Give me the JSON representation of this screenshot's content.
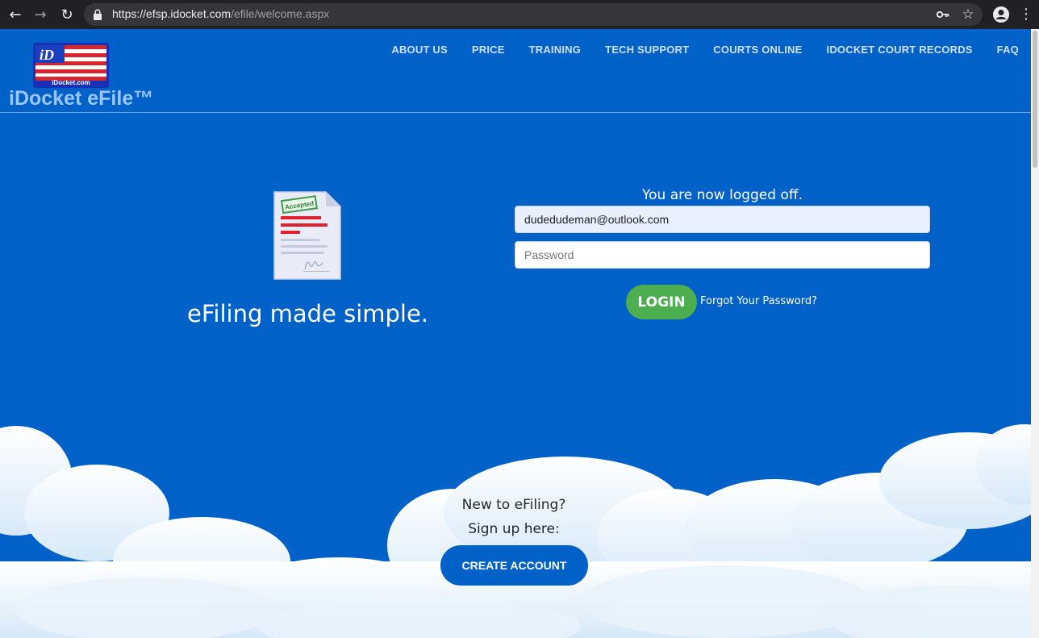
{
  "browser": {
    "url_host": "https://efsp.idocket.com",
    "url_path": "/efile/welcome.aspx"
  },
  "header": {
    "logo_text": "iDocket.com",
    "brand": "iDocket eFile™",
    "nav": [
      "ABOUT US",
      "PRICE",
      "TRAINING",
      "TECH SUPPORT",
      "COURTS ONLINE",
      "IDOCKET COURT RECORDS",
      "FAQ"
    ]
  },
  "hero": {
    "stamp_text": "Accepted",
    "tagline": "eFiling made simple."
  },
  "login": {
    "status": "You are now logged off.",
    "email_value": "dudedudeman@outlook.com",
    "password_placeholder": "Password",
    "login_label": "LOGIN",
    "forgot_label": "Forgot Your Password?"
  },
  "signup": {
    "line1": "New to eFiling?",
    "line2": "Sign up here:",
    "create_label": "CREATE ACCOUNT"
  },
  "colors": {
    "page_bg": "#0061c9",
    "login_button": "#4cae4f",
    "brand_text": "#9cc6ff"
  },
  "icons": [
    "back-arrow-icon",
    "forward-arrow-icon",
    "reload-icon",
    "lock-icon",
    "key-icon",
    "star-icon",
    "account-icon",
    "menu-icon"
  ]
}
